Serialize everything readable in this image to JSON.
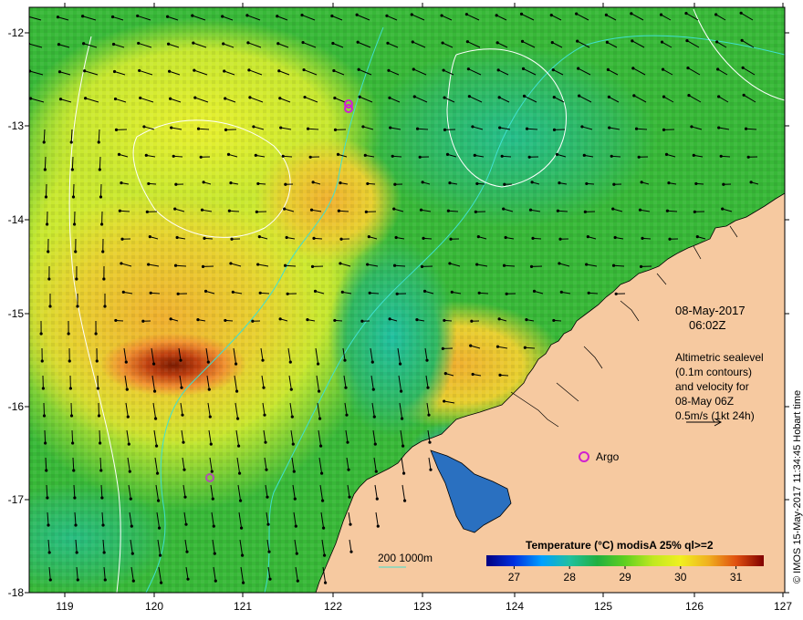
{
  "map": {
    "lon_ticks": [
      "119",
      "120",
      "121",
      "122",
      "123",
      "124",
      "125",
      "126",
      "127"
    ],
    "lat_ticks": [
      "-12",
      "-13",
      "-14",
      "-15",
      "-16",
      "-17",
      "-18"
    ],
    "datetime_line1": "08-May-2017",
    "datetime_line2": "06:02Z",
    "altimetry_line1": "Altimetric sealevel",
    "altimetry_line2": "(0.1m contours)",
    "altimetry_line3": "and velocity for",
    "altimetry_line4": "08-May 06Z",
    "altimetry_line5": "0.5m/s (1kt 24h)",
    "argo_label": "Argo",
    "bathy_legend": "200  1000m",
    "credit": "© IMOS 15-May-2017 11:34:45 Hobart time",
    "colors": {
      "land": "#f6c9a0",
      "ocean_base": "#3fbf3f",
      "argo_marker": "#d020d0",
      "bathy_contour": "#40e0d0",
      "sealevel_contour": "#ffffff"
    }
  },
  "colorbar": {
    "title": "Temperature  (°C) modisA 25% ql>=2",
    "ticks": [
      "27",
      "28",
      "29",
      "30",
      "31"
    ],
    "range": [
      26.5,
      31.5
    ],
    "colors": [
      "#000080",
      "#0040ff",
      "#00c0ff",
      "#20c060",
      "#10a020",
      "#a0e020",
      "#f0f020",
      "#f0a020",
      "#d05010",
      "#800000"
    ]
  }
}
